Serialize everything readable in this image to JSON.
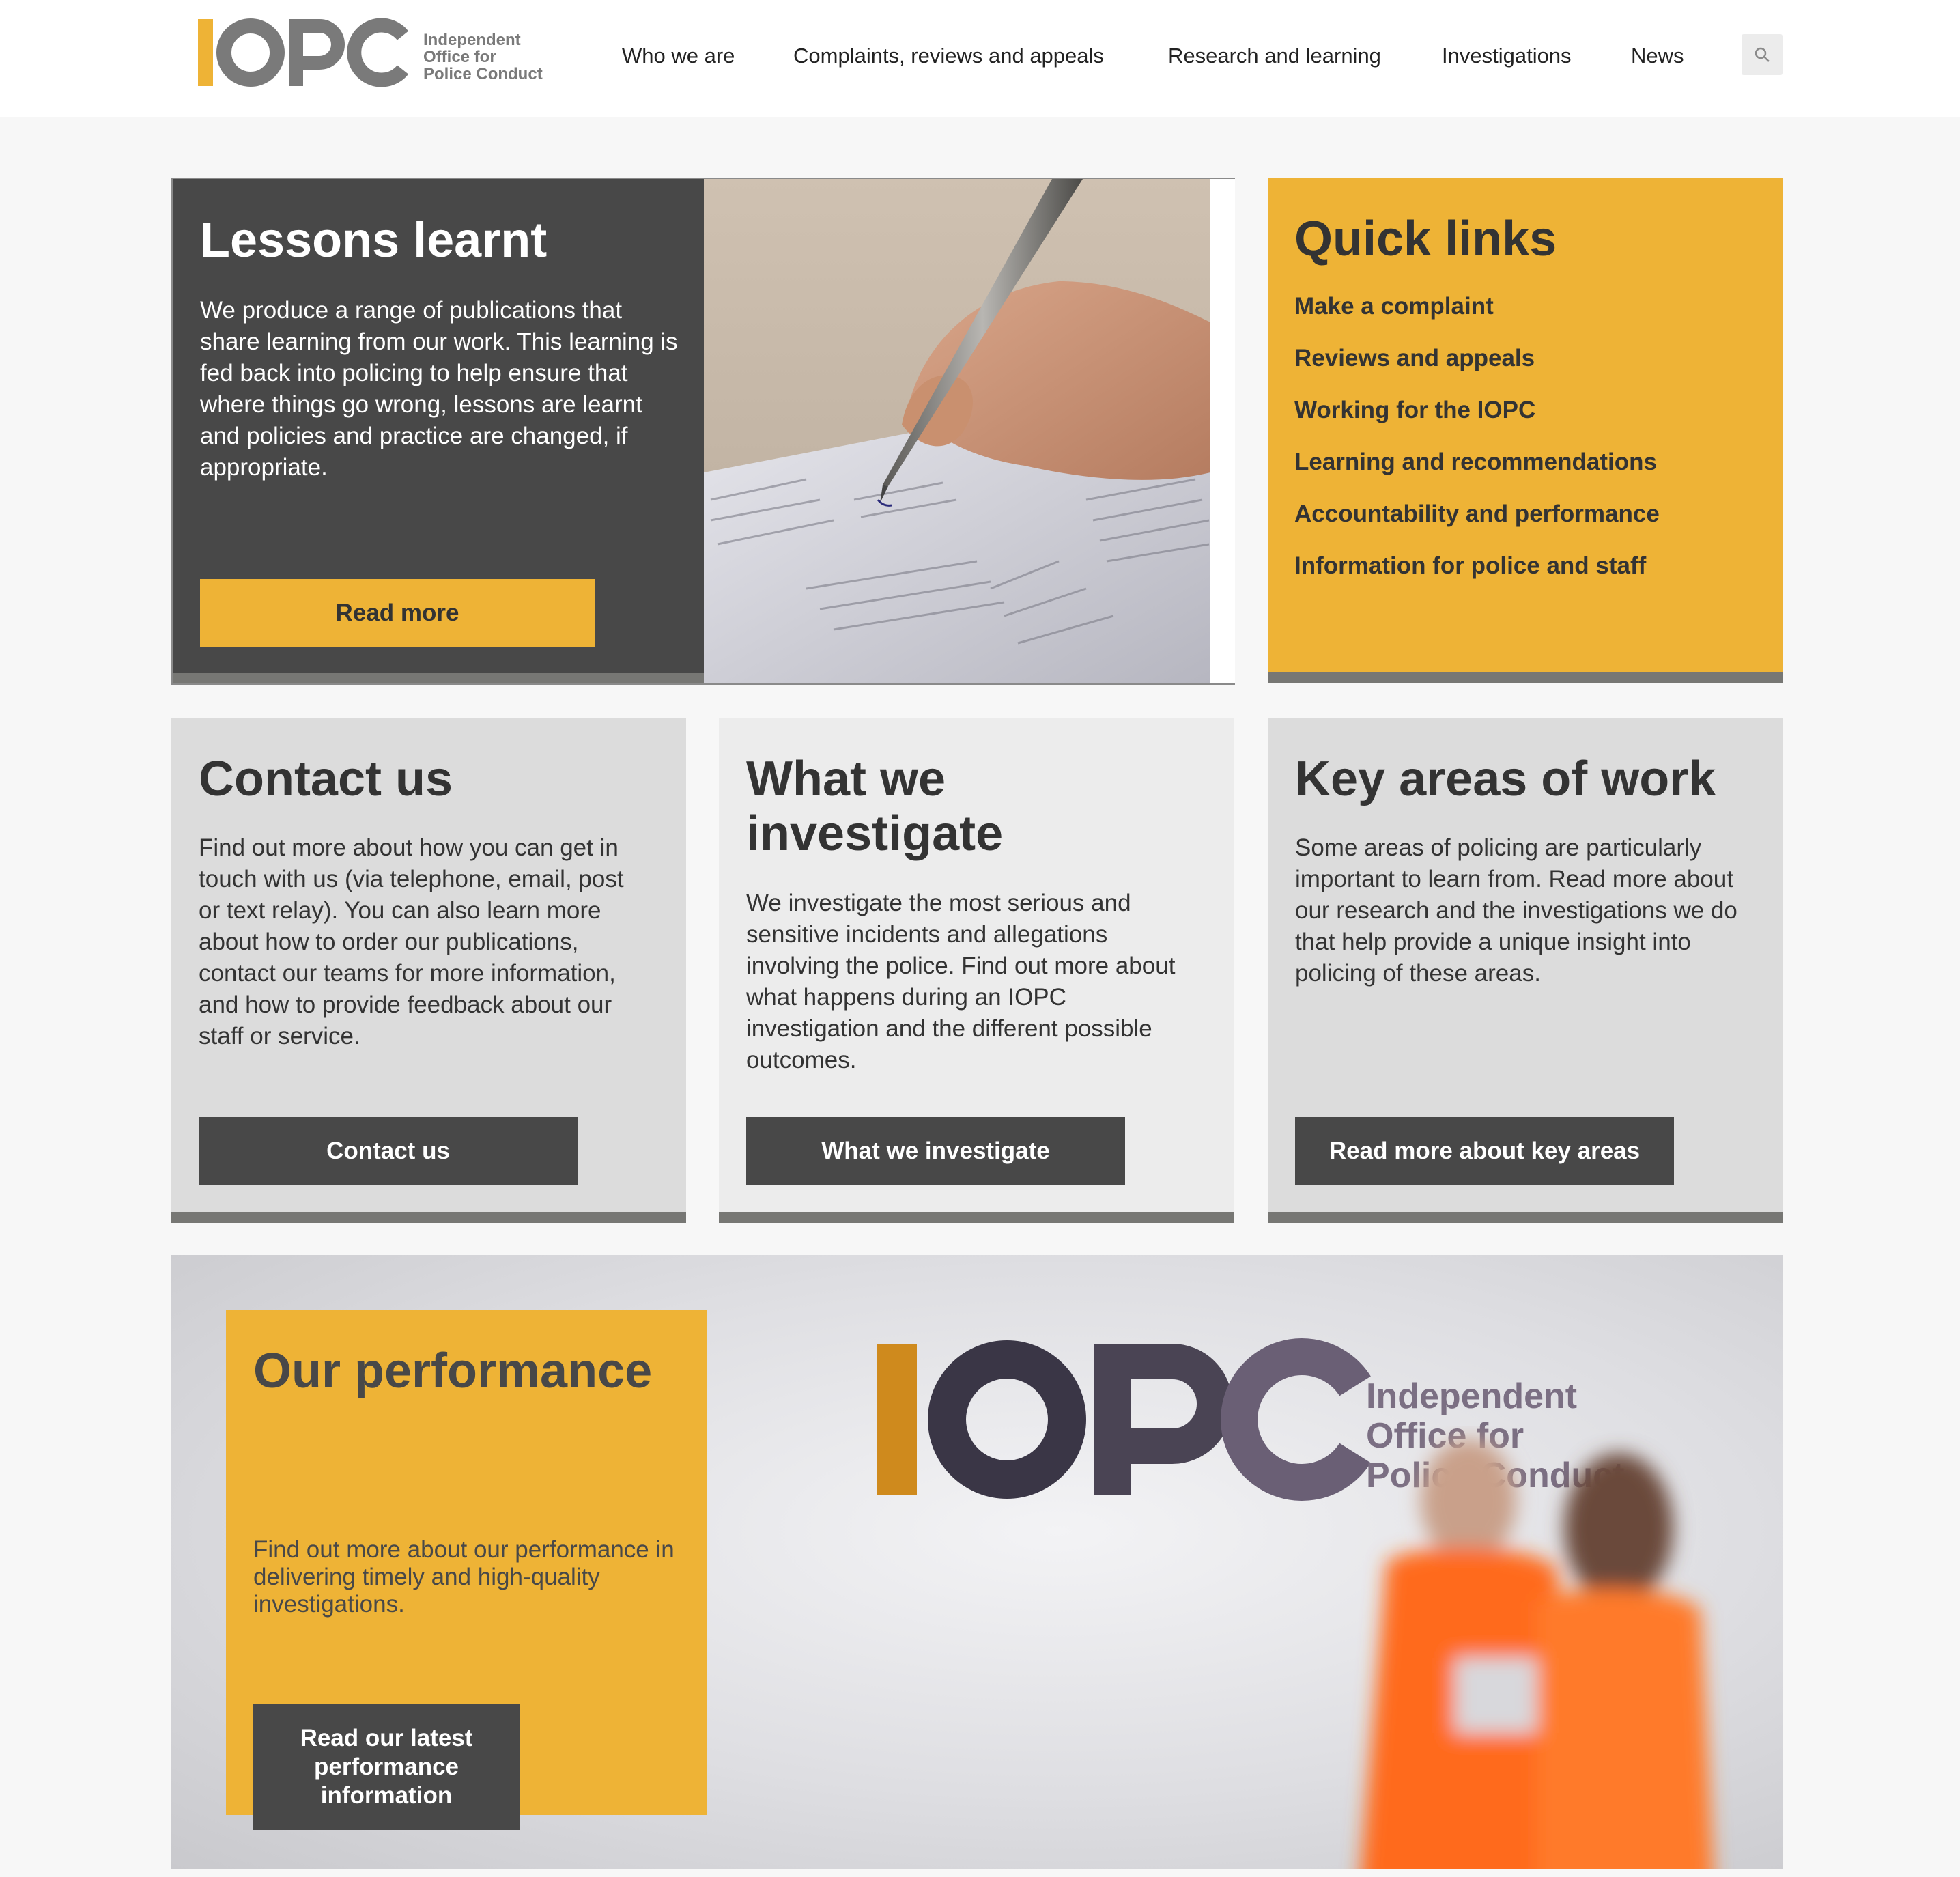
{
  "header": {
    "logo_mark": "IOPC",
    "logo_lines": [
      "Independent",
      "Office for",
      "Police Conduct"
    ],
    "nav": [
      {
        "label": "Who we are"
      },
      {
        "label": "Complaints, reviews and appeals"
      },
      {
        "label": "Research and learning"
      },
      {
        "label": "Investigations"
      },
      {
        "label": "News"
      }
    ],
    "search_icon": "search-icon"
  },
  "lessons": {
    "title": "Lessons learnt",
    "body": "We produce a range of publications that share learning from our work. This learning is fed back into policing to help ensure that where things go wrong, lessons are learnt and policies and practice are changed, if appropriate.",
    "button": "Read more"
  },
  "quick_links": {
    "title": "Quick links",
    "items": [
      "Make a complaint",
      "Reviews and appeals",
      "Working for the IOPC",
      "Learning and recommendations",
      "Accountability and performance",
      "Information for police and staff"
    ]
  },
  "contact": {
    "title": "Contact us",
    "body": "Find out more about how you can get in touch with us (via telephone, email, post or text relay). You can also learn more about how to order our publications, contact our teams for more information, and how to provide feedback about our staff or service.",
    "button": "Contact us"
  },
  "investigate": {
    "title": "What we investigate",
    "body": "We investigate the most serious and sensitive incidents and allegations involving the police. Find out more about what happens during an IOPC investigation and the different possible outcomes.",
    "button": "What we investigate"
  },
  "key_areas": {
    "title": "Key areas of work",
    "body": "Some areas of policing are particularly important to learn from. Read more about our research and the investigations we do that help provide a unique insight into policing of these areas.",
    "button": "Read more about key areas"
  },
  "performance": {
    "title": "Our performance",
    "body": "Find out more about our performance in delivering timely and high-quality investigations.",
    "button": "Read our latest performance information",
    "wall_logo": "IOPC",
    "wall_lines": [
      "Independent",
      "Office for",
      "Police Conduct"
    ]
  },
  "colors": {
    "brand_yellow": "#eeb336",
    "dark_grey": "#484848",
    "logo_grey": "#7a7a7a"
  }
}
